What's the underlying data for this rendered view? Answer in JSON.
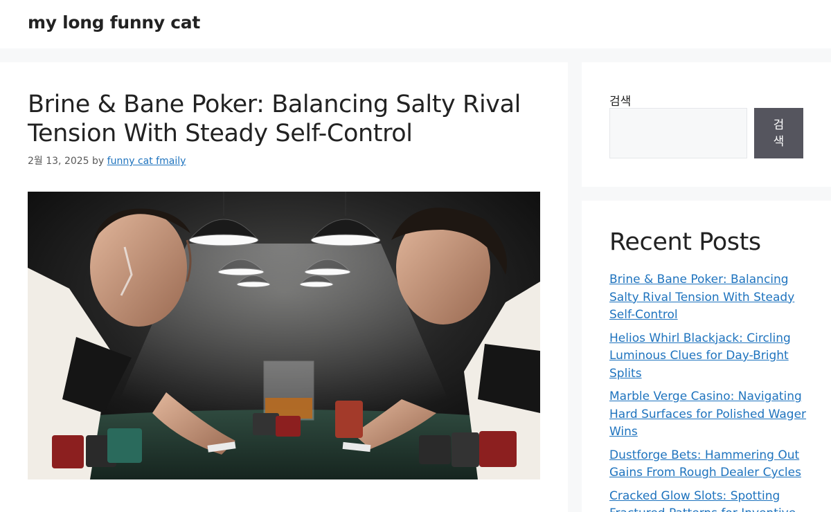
{
  "site": {
    "title": "my long funny cat"
  },
  "post": {
    "title": "Brine & Bane Poker: Balancing Salty Rival Tension With Steady Self-Control",
    "date": "2월 13, 2025",
    "by": "by",
    "author": "funny cat fmaily",
    "image_alt": "Two men in vests facing each other across a poker table with chips and a glass of whiskey under hanging lamps"
  },
  "sidebar": {
    "search": {
      "label": "검색",
      "placeholder": "",
      "button_label": "검색"
    },
    "recent_posts": {
      "title": "Recent Posts",
      "items": [
        {
          "label": "Brine & Bane Poker: Balancing Salty Rival Tension With Steady Self-Control"
        },
        {
          "label": "Helios Whirl Blackjack: Circling Luminous Clues for Day-Bright Splits"
        },
        {
          "label": "Marble Verge Casino: Navigating Hard Surfaces for Polished Wager Wins"
        },
        {
          "label": "Dustforge Bets: Hammering Out Gains From Rough Dealer Cycles"
        },
        {
          "label": "Cracked Glow Slots: Spotting Fractured Patterns for Inventive"
        }
      ]
    }
  },
  "colors": {
    "link": "#1e73be",
    "background": "#f7f8f9",
    "button": "#55555e",
    "text": "#222222"
  }
}
